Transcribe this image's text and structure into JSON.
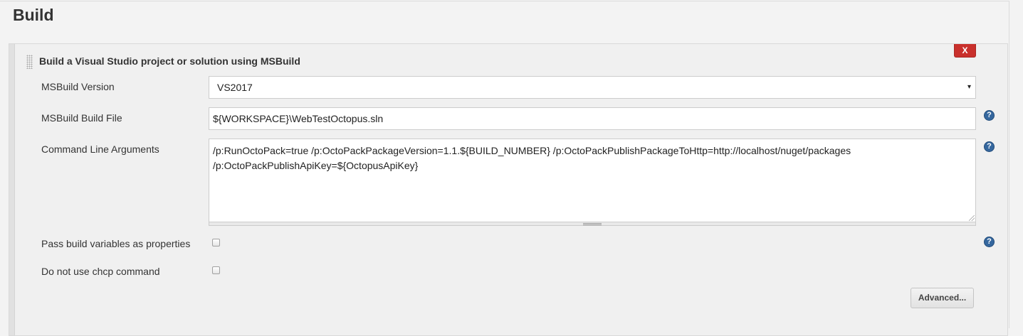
{
  "section": {
    "title": "Build"
  },
  "step": {
    "title": "Build a Visual Studio project or solution using MSBuild",
    "delete_label": "X"
  },
  "fields": {
    "msbuild_version": {
      "label": "MSBuild Version",
      "value": "VS2017"
    },
    "build_file": {
      "label": "MSBuild Build File",
      "value": "${WORKSPACE}\\WebTestOctopus.sln"
    },
    "cmd_args": {
      "label": "Command Line Arguments",
      "line1": "/p:RunOctoPack=true /p:OctoPackPackageVersion=1.1.${BUILD_NUMBER} /p:OctoPackPublishPackageToHttp=http://localhost/nuget/packages",
      "line2": "/p:OctoPackPublishApiKey=${OctopusApiKey}"
    },
    "pass_build_vars": {
      "label": "Pass build variables as properties",
      "checked": false
    },
    "no_chcp": {
      "label": "Do not use chcp command",
      "checked": false
    }
  },
  "help_icon_glyph": "?",
  "dropdown_arrow_glyph": "▾",
  "buttons": {
    "advanced_label": "Advanced..."
  },
  "icons": [
    "drag-handle-icon",
    "help-icon",
    "chevron-down-icon"
  ],
  "colors": {
    "delete": "#c9302c",
    "help": "#35679e"
  }
}
